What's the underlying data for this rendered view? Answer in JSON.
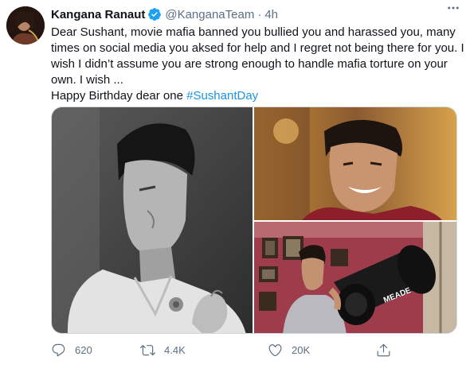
{
  "author": {
    "name": "Kangana Ranaut",
    "handle": "@KanganaTeam",
    "separator": "·",
    "time": "4h",
    "verified": true
  },
  "tweet": {
    "lines": [
      "Dear Sushant, movie mafia banned you bullied you and harassed you, many times on social media you aksed for help and I regret not being there for you. I wish I didn’t assume you are strong enough to handle mafia torture on your own. I wish ..."
    ],
    "closing_text": "Happy Birthday dear one ",
    "hashtag": "#SushantDay"
  },
  "media": {
    "images": [
      {
        "id": "portrait-bw",
        "icon": "photo-black-white-portrait"
      },
      {
        "id": "smiling",
        "icon": "photo-smiling-man"
      },
      {
        "id": "telescope",
        "icon": "photo-man-with-telescope"
      }
    ],
    "telescope_brand": "MEADE"
  },
  "actions": {
    "reply_count": "620",
    "retweet_count": "4.4K",
    "like_count": "20K",
    "share_icon": "share-icon"
  },
  "colors": {
    "link": "#1b95e0",
    "secondary_text": "#5b7083",
    "verified_badge": "#1da1f2"
  }
}
